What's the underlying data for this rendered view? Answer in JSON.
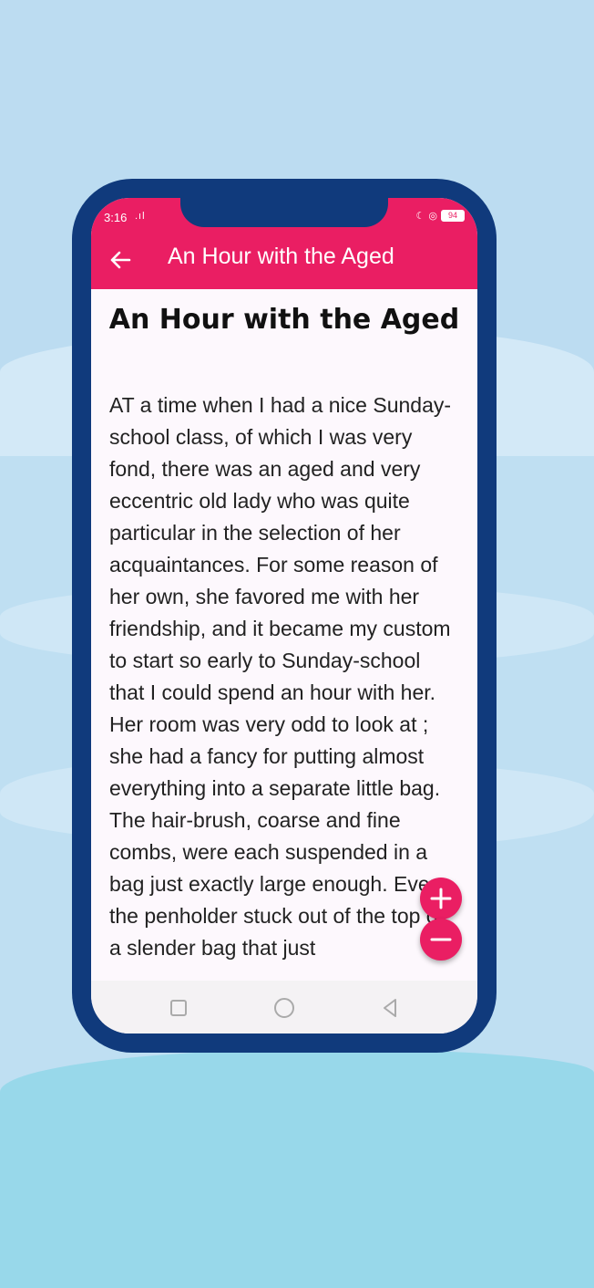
{
  "status_bar": {
    "time": "3:16",
    "signal": ".ıl",
    "battery": "94"
  },
  "app_bar": {
    "title": "An Hour with the Aged"
  },
  "story": {
    "title": "An Hour with the Aged",
    "body": "AT a time when I had a nice Sunday-school class, of which I was very fond, there was an aged and very eccentric old lady who was quite particular in the selection of her acquaintances. For some reason of her own, she favored me with her friendship, and it became my custom to start so early to Sunday-school that I could spend an hour with her. Her room was very odd to look at ; she had a fancy for putting almost everything into a separate little bag. The hair-brush, coarse and fine combs, were each suspended in a bag just exactly large enough. Even the penholder stuck out of the top of a slender bag that just"
  },
  "icons": {
    "back": "arrow-back-icon",
    "zoom_in": "plus-icon",
    "zoom_out": "minus-icon",
    "nav_recent": "square-icon",
    "nav_home": "circle-icon",
    "nav_back": "triangle-icon"
  },
  "colors": {
    "accent": "#ea1e63",
    "frame": "#103a7c",
    "background": "#bfe0f3"
  }
}
